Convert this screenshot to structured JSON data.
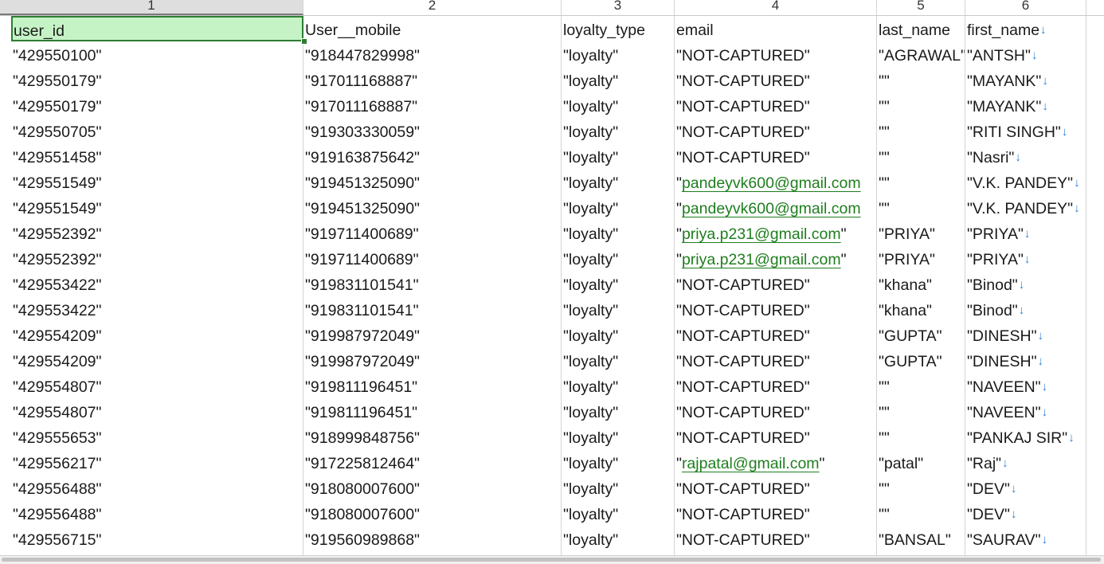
{
  "window": {
    "accent_color": "#2e7d32",
    "selected_fill": "#c6f3c6",
    "link_color": "#1e7e1e",
    "arrow_color": "#2f7fd6"
  },
  "column_headers": [
    "1",
    "2",
    "3",
    "4",
    "5",
    "6"
  ],
  "header_row": {
    "user_id": "user_id",
    "user_mobile": "User__mobile",
    "loyalty_type": "loyalty_type",
    "email": "email",
    "last_name": "last_name",
    "first_name": "first_name",
    "arrow": "↓"
  },
  "rows": [
    {
      "user_id": "\"429550100\"",
      "mobile": "\"918447829998\"",
      "loyalty": "\"loyalty\"",
      "email": "\"NOT-CAPTURED\"",
      "last_name": "\"AGRAWAL\"",
      "first_name": "\"ANTSH\"",
      "arrow": "↓"
    },
    {
      "user_id": "\"429550179\"",
      "mobile": "\"917011168887\"",
      "loyalty": "\"loyalty\"",
      "email": "\"NOT-CAPTURED\"",
      "last_name": "\"\"",
      "first_name": "\"MAYANK\"",
      "arrow": "↓"
    },
    {
      "user_id": "\"429550179\"",
      "mobile": "\"917011168887\"",
      "loyalty": "\"loyalty\"",
      "email": "\"NOT-CAPTURED\"",
      "last_name": "\"\"",
      "first_name": "\"MAYANK\"",
      "arrow": "↓"
    },
    {
      "user_id": "\"429550705\"",
      "mobile": "\"919303330059\"",
      "loyalty": "\"loyalty\"",
      "email": "\"NOT-CAPTURED\"",
      "last_name": "\"\"",
      "first_name": "\"RITI SINGH\"",
      "arrow": "↓"
    },
    {
      "user_id": "\"429551458\"",
      "mobile": "\"919163875642\"",
      "loyalty": "\"loyalty\"",
      "email": "\"NOT-CAPTURED\"",
      "last_name": "\"\"",
      "first_name": "\"Nasri\"",
      "arrow": "↓"
    },
    {
      "user_id": "\"429551549\"",
      "mobile": "\"919451325090\"",
      "loyalty": "\"loyalty\"",
      "email_q": "\"",
      "email_link": "pandeyvk600@gmail.com",
      "last_name": "\"\"",
      "first_name": "\"V.K. PANDEY\"",
      "arrow": "↓"
    },
    {
      "user_id": "\"429551549\"",
      "mobile": "\"919451325090\"",
      "loyalty": "\"loyalty\"",
      "email_q": "\"",
      "email_link": "pandeyvk600@gmail.com",
      "last_name": "\"\"",
      "first_name": "\"V.K. PANDEY\"",
      "arrow": "↓"
    },
    {
      "user_id": "\"429552392\"",
      "mobile": "\"919711400689\"",
      "loyalty": "\"loyalty\"",
      "email_q": "\"",
      "email_link": "priya.p231@gmail.com",
      "email_tail": "\"",
      "last_name": "\"PRIYA\"",
      "first_name": "\"PRIYA\"",
      "arrow": "↓"
    },
    {
      "user_id": "\"429552392\"",
      "mobile": "\"919711400689\"",
      "loyalty": "\"loyalty\"",
      "email_q": "\"",
      "email_link": "priya.p231@gmail.com",
      "email_tail": "\"",
      "last_name": "\"PRIYA\"",
      "first_name": "\"PRIYA\"",
      "arrow": "↓"
    },
    {
      "user_id": "\"429553422\"",
      "mobile": "\"919831101541\"",
      "loyalty": "\"loyalty\"",
      "email": "\"NOT-CAPTURED\"",
      "last_name": "\"khana\"",
      "first_name": "\"Binod\"",
      "arrow": "↓"
    },
    {
      "user_id": "\"429553422\"",
      "mobile": "\"919831101541\"",
      "loyalty": "\"loyalty\"",
      "email": "\"NOT-CAPTURED\"",
      "last_name": "\"khana\"",
      "first_name": "\"Binod\"",
      "arrow": "↓"
    },
    {
      "user_id": "\"429554209\"",
      "mobile": "\"919987972049\"",
      "loyalty": "\"loyalty\"",
      "email": "\"NOT-CAPTURED\"",
      "last_name": "\"GUPTA\"",
      "first_name": "\"DINESH\"",
      "arrow": "↓"
    },
    {
      "user_id": "\"429554209\"",
      "mobile": "\"919987972049\"",
      "loyalty": "\"loyalty\"",
      "email": "\"NOT-CAPTURED\"",
      "last_name": "\"GUPTA\"",
      "first_name": "\"DINESH\"",
      "arrow": "↓"
    },
    {
      "user_id": "\"429554807\"",
      "mobile": "\"919811196451\"",
      "loyalty": "\"loyalty\"",
      "email": "\"NOT-CAPTURED\"",
      "last_name": "\"\"",
      "first_name": "\"NAVEEN\"",
      "arrow": "↓"
    },
    {
      "user_id": "\"429554807\"",
      "mobile": "\"919811196451\"",
      "loyalty": "\"loyalty\"",
      "email": "\"NOT-CAPTURED\"",
      "last_name": "\"\"",
      "first_name": "\"NAVEEN\"",
      "arrow": "↓"
    },
    {
      "user_id": "\"429555653\"",
      "mobile": "\"918999848756\"",
      "loyalty": "\"loyalty\"",
      "email": "\"NOT-CAPTURED\"",
      "last_name": "\"\"",
      "first_name": "\"PANKAJ SIR\"",
      "arrow": "↓"
    },
    {
      "user_id": "\"429556217\"",
      "mobile": "\"917225812464\"",
      "loyalty": "\"loyalty\"",
      "email_q": "\"",
      "email_link": "rajpatal@gmail.com",
      "email_tail": "\"",
      "last_name": "\"patal\"",
      "first_name": "\"Raj\"",
      "arrow": "↓"
    },
    {
      "user_id": "\"429556488\"",
      "mobile": "\"918080007600\"",
      "loyalty": "\"loyalty\"",
      "email": "\"NOT-CAPTURED\"",
      "last_name": "\"\"",
      "first_name": "\"DEV\"",
      "arrow": "↓"
    },
    {
      "user_id": "\"429556488\"",
      "mobile": "\"918080007600\"",
      "loyalty": "\"loyalty\"",
      "email": "\"NOT-CAPTURED\"",
      "last_name": "\"\"",
      "first_name": "\"DEV\"",
      "arrow": "↓"
    },
    {
      "user_id": "\"429556715\"",
      "mobile": "\"919560989868\"",
      "loyalty": "\"loyalty\"",
      "email": "\"NOT-CAPTURED\"",
      "last_name": "\"BANSAL\"",
      "first_name": "\"SAURAV\"",
      "arrow": "↓"
    }
  ]
}
